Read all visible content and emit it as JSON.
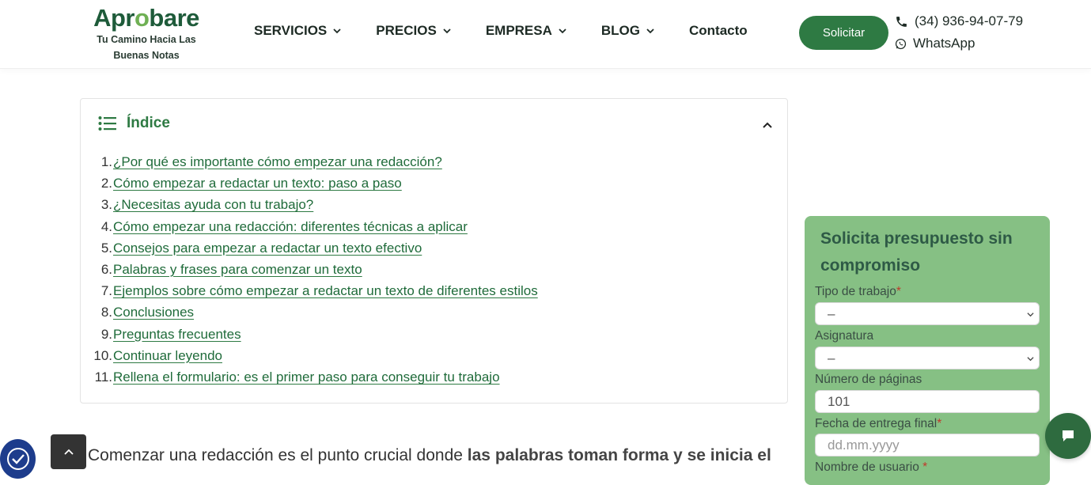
{
  "header": {
    "logo": {
      "word_start": "Apr",
      "word_o": "o",
      "word_end": "bare",
      "tagline_1": "Tu Camino Hacia Las",
      "tagline_2": "Buenas Notas"
    },
    "nav": [
      {
        "label": "SERVICIOS",
        "has_dropdown": true
      },
      {
        "label": "PRECIOS",
        "has_dropdown": true
      },
      {
        "label": "EMPRESA",
        "has_dropdown": true
      },
      {
        "label": "BLOG",
        "has_dropdown": true
      },
      {
        "label": "Contacto",
        "has_dropdown": false
      }
    ],
    "cta_label": "Solicitar",
    "phone": "(34) 936-94-07-79",
    "whatsapp": "WhatsApp"
  },
  "toc": {
    "title": "Índice",
    "items": [
      {
        "num": "1.",
        "label": "¿Por qué es importante cómo empezar una redacción?"
      },
      {
        "num": "2.",
        "label": "Cómo empezar a redactar un texto: paso a paso"
      },
      {
        "num": "3.",
        "label": "¿Necesitas ayuda con tu trabajo?"
      },
      {
        "num": "4.",
        "label": "Cómo empezar una redacción: diferentes técnicas a aplicar"
      },
      {
        "num": "5.",
        "label": "Consejos para empezar a redactar un texto efectivo"
      },
      {
        "num": "6.",
        "label": "Palabras y frases para comenzar un texto"
      },
      {
        "num": "7.",
        "label": "Ejemplos sobre cómo empezar a redactar un texto de diferentes estilos"
      },
      {
        "num": "8.",
        "label": "Conclusiones"
      },
      {
        "num": "9.",
        "label": "Preguntas frecuentes"
      },
      {
        "num": "10.",
        "label": "Continuar leyendo"
      },
      {
        "num": "11.",
        "label": "Rellena el formulario: es el primer paso para conseguir tu trabajo"
      }
    ]
  },
  "form": {
    "title": "Solicita presupuesto sin compromiso",
    "tipo_label": "Tipo de trabajo",
    "tipo_value": "–",
    "asignatura_label": "Asignatura",
    "asignatura_value": "–",
    "paginas_label": "Número de páginas",
    "paginas_value": "101",
    "fecha_label": "Fecha de entrega final",
    "fecha_placeholder": "dd.mm.yyyy",
    "usuario_label": "Nombre de usuario",
    "required_mark": "*"
  },
  "body": {
    "lead_plain": "Comenzar una redacción es el punto crucial donde ",
    "lead_bold": "las palabras toman forma y se inicia el"
  },
  "colors": {
    "brand_green": "#2e7a43",
    "form_bg": "#86c084",
    "link": "#1f6b3a"
  }
}
